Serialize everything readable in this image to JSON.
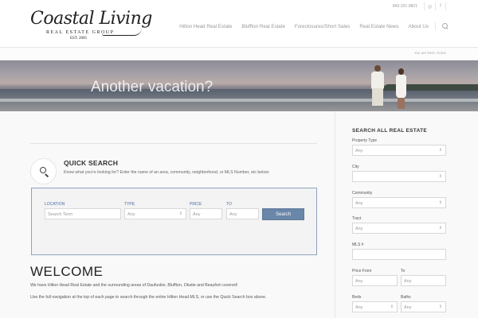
{
  "header": {
    "logo": {
      "main": "Coastal Living",
      "sub": "REAL ESTATE GROUP",
      "est": "EST. 2005"
    },
    "phone": "843-321-9821",
    "social": [
      {
        "icon": "instagram-icon",
        "glyph": "◎"
      },
      {
        "icon": "facebook-icon",
        "glyph": "f"
      }
    ],
    "nav": [
      "Hilton Head Real Estate",
      "Bluffton Real Estate",
      "Foreclosures/Short Sales",
      "Real Estate News",
      "About Us"
    ]
  },
  "breadcrumb": {
    "prefix": "You are here:",
    "current": "Home"
  },
  "hero": {
    "title": "Another vacation?"
  },
  "quick_search": {
    "title": "QUICK SEARCH",
    "description": "Know what you're looking for?  Enter the name of an area, community, neighborhood, or MLS Number, etc below:",
    "location_label": "LOCATION",
    "location_placeholder": "Search Term",
    "type_label": "TYPE",
    "type_value": "Any",
    "price_label": "PRICE",
    "price_value": "Any",
    "to_label": "TO",
    "to_value": "Any",
    "button": "Search"
  },
  "welcome": {
    "title": "WELCOME",
    "para1": "We have Hilton Head Real Estate and the surrounding areas of Daufuskie, Bluffton, Okatie and Beaufort covered!",
    "para2": "Use the full navigation at the top of each page to search through the entire Hilton Head MLS, or use the Quick Search box above."
  },
  "sidebar": {
    "title": "SEARCH ALL REAL ESTATE",
    "property_type_label": "Property Type",
    "property_type_value": "Any",
    "city_label": "City",
    "city_value": "",
    "community_label": "Community",
    "community_value": "Any",
    "tract_label": "Tract",
    "tract_value": "Any",
    "mls_label": "MLS #",
    "mls_value": "",
    "price_from_label": "Price From",
    "price_from_value": "Any",
    "price_to_label": "To",
    "price_to_value": "Any",
    "beds_label": "Beds",
    "beds_value": "Any",
    "baths_label": "Baths",
    "baths_value": "Any"
  }
}
